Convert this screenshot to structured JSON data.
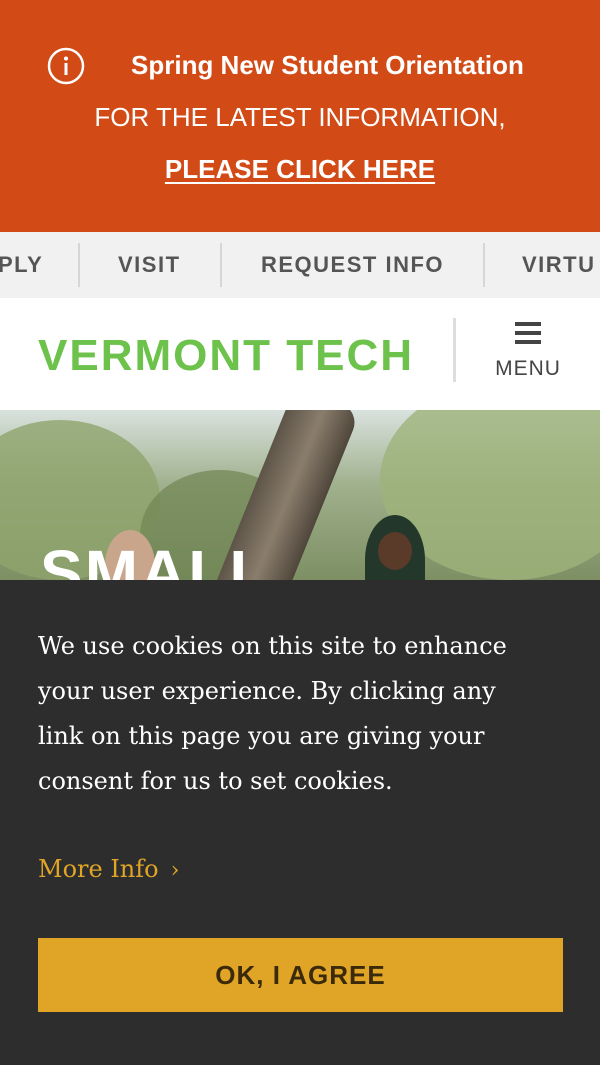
{
  "alert": {
    "icon": "info-icon",
    "title": "Spring New Student Orientation",
    "line": "FOR THE LATEST INFORMATION,",
    "link": "PLEASE CLICK HERE",
    "background": "#d24b17"
  },
  "quick_nav": {
    "items": [
      "PLY",
      "VISIT",
      "REQUEST INFO",
      "VIRTU"
    ]
  },
  "header": {
    "logo": "VERMONT TECH",
    "logo_color": "#6cc24a",
    "menu_icon": "hamburger-icon",
    "menu_label": "MENU"
  },
  "hero": {
    "headline": "SMALL"
  },
  "cookie": {
    "message": "We use cookies on this site to enhance your user experience. By clicking any link on this page you are giving your consent for us to set cookies.",
    "more_info": "More Info",
    "more_info_icon": "chevron-right-icon",
    "agree_button": "OK, I AGREE",
    "accent": "#e0a526",
    "background": "#2d2d2d"
  }
}
